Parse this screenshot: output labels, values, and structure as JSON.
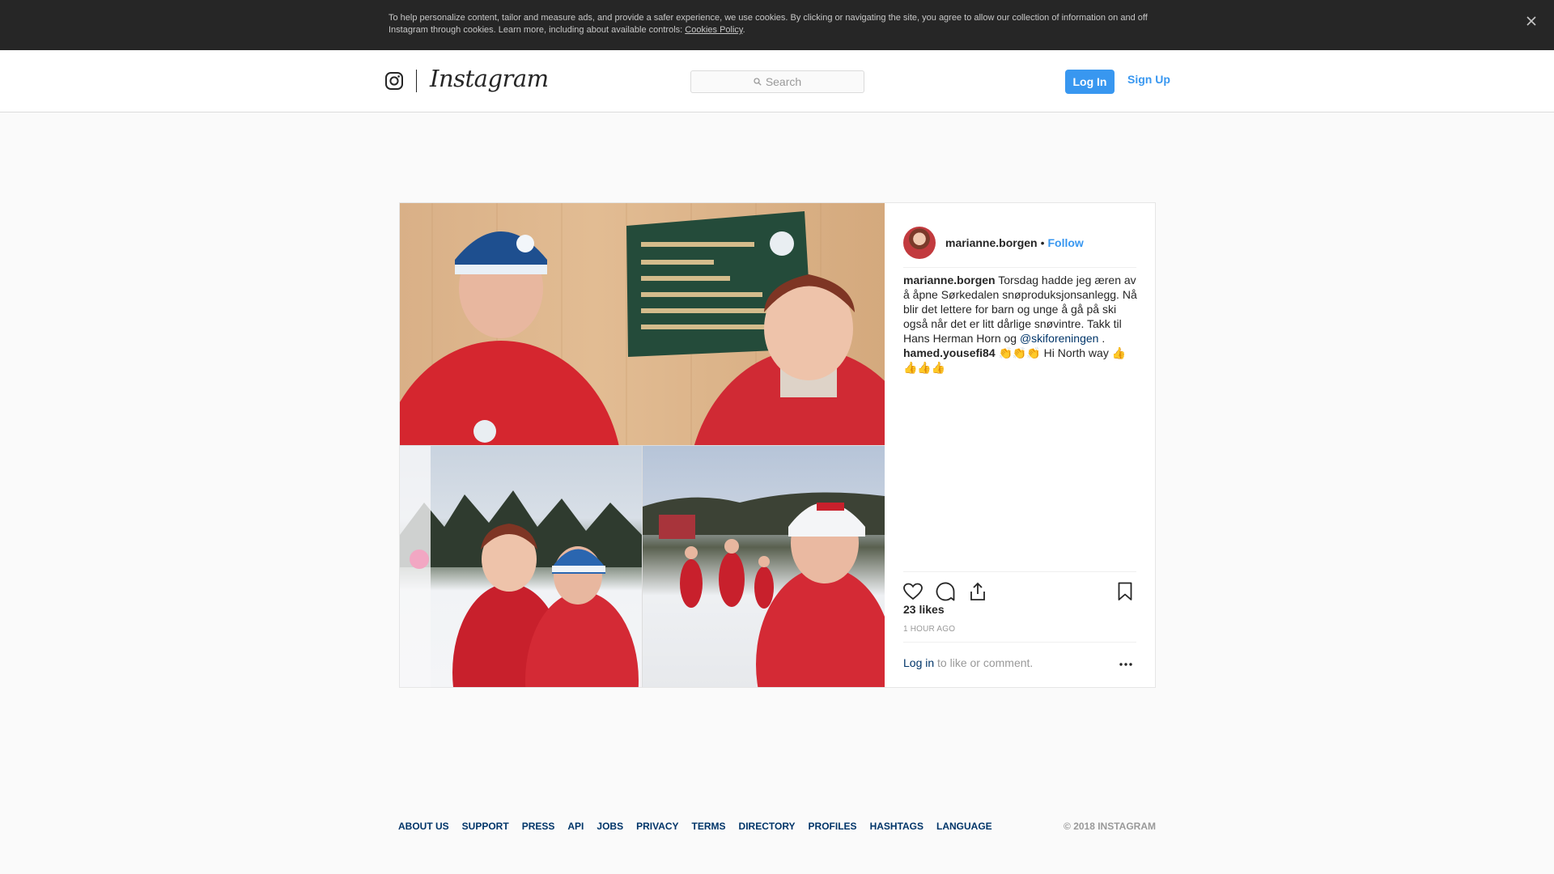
{
  "cookie_banner": {
    "text": "To help personalize content, tailor and measure ads, and provide a safer experience, we use cookies. By clicking or navigating the site, you agree to allow our collection of information on and off Instagram through cookies. Learn more, including about available controls: ",
    "link": "Cookies Policy",
    "close_icon": "close-icon"
  },
  "header": {
    "logo_icon": "instagram-glyph-icon",
    "wordmark": "Instagram",
    "search_placeholder": "Search",
    "login_label": "Log In",
    "signup_label": "Sign Up"
  },
  "post": {
    "author": "marianne.borgen",
    "separator": "•",
    "follow_label": "Follow",
    "caption_text": "Torsdag hadde jeg æren av å åpne Sørkedalen snøproduksjonsanlegg. Nå blir det lettere for barn og unge å gå på ski også når det er litt dårlige snøvintre. Takk til Hans Herman Horn og ",
    "caption_mention": "@skiforeningen",
    "caption_end": " .",
    "comments": [
      {
        "user": "hamed.yousefi84",
        "text": " 👏👏👏  Hi North way 👍👍👍👍"
      }
    ],
    "likes": "23 likes",
    "timestamp": "1 hour ago",
    "login_link": "Log in",
    "login_prompt": " to like or comment.",
    "colors": {
      "accent": "#3897f0",
      "link": "#003569"
    }
  },
  "footer": {
    "links": [
      "ABOUT US",
      "SUPPORT",
      "PRESS",
      "API",
      "JOBS",
      "PRIVACY",
      "TERMS",
      "DIRECTORY",
      "PROFILES",
      "HASHTAGS",
      "LANGUAGE"
    ],
    "copyright": "© 2018 INSTAGRAM"
  }
}
